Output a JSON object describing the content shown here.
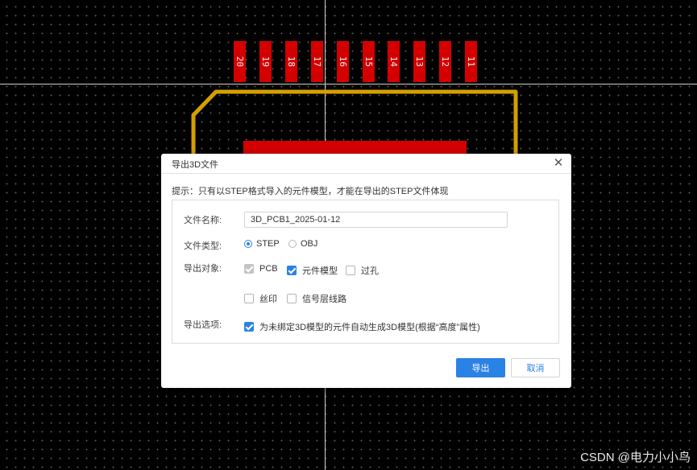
{
  "canvas": {
    "pads": [
      "20",
      "19",
      "18",
      "17",
      "16",
      "15",
      "14",
      "13",
      "12",
      "11"
    ],
    "colors": {
      "pad": "#d40000",
      "outline": "#d4a000",
      "crosshair": "#cfcfcf"
    }
  },
  "dialog": {
    "title": "导出3D文件",
    "close_icon": "close-icon",
    "hint": "提示：只有以STEP格式导入的元件模型，才能在导出的STEP文件体现",
    "file_name": {
      "label": "文件名称:",
      "value": "3D_PCB1_2025-01-12"
    },
    "file_type": {
      "label": "文件类型:",
      "options": [
        {
          "label": "STEP",
          "selected": true
        },
        {
          "label": "OBJ",
          "selected": false
        }
      ]
    },
    "export_objects": {
      "label": "导出对象:",
      "options": [
        {
          "label": "PCB",
          "checked": true,
          "disabled": true
        },
        {
          "label": "元件模型",
          "checked": true,
          "disabled": false
        },
        {
          "label": "过孔",
          "checked": false,
          "disabled": false
        },
        {
          "label": "丝印",
          "checked": false,
          "disabled": false
        },
        {
          "label": "信号层线路",
          "checked": false,
          "disabled": false
        }
      ]
    },
    "export_options": {
      "label": "导出选项:",
      "option": {
        "label": "为未绑定3D模型的元件自动生成3D模型(根据“高度”属性)",
        "checked": true
      }
    },
    "buttons": {
      "export": "导出",
      "cancel": "取消"
    },
    "accent_color": "#2a82e4"
  },
  "watermark": "CSDN @电力小小鸟"
}
